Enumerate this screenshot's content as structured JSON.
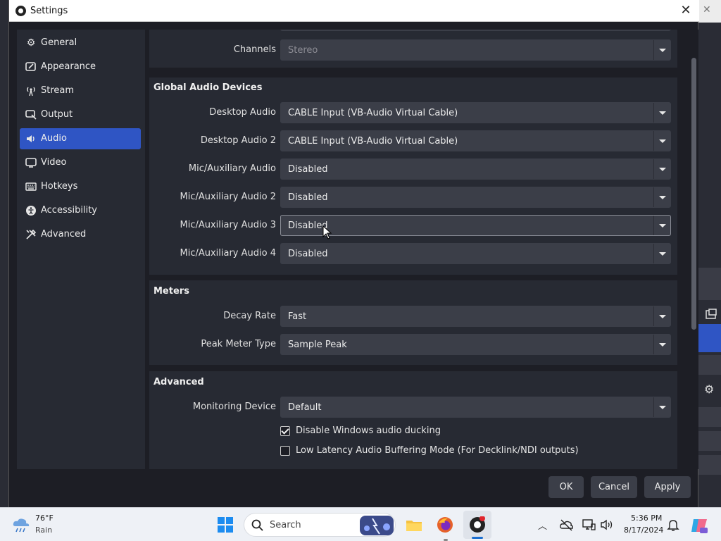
{
  "window": {
    "title": "Settings"
  },
  "sidebar": {
    "items": [
      {
        "label": "General",
        "icon": "gear-icon"
      },
      {
        "label": "Appearance",
        "icon": "appearance-icon"
      },
      {
        "label": "Stream",
        "icon": "antenna-icon"
      },
      {
        "label": "Output",
        "icon": "output-icon"
      },
      {
        "label": "Audio",
        "icon": "speaker-icon",
        "active": true
      },
      {
        "label": "Video",
        "icon": "monitor-icon"
      },
      {
        "label": "Hotkeys",
        "icon": "keyboard-icon"
      },
      {
        "label": "Accessibility",
        "icon": "accessibility-icon"
      },
      {
        "label": "Advanced",
        "icon": "tools-icon"
      }
    ]
  },
  "general": {
    "channels_label": "Channels",
    "channels_value": "Stereo"
  },
  "global_audio": {
    "title": "Global Audio Devices",
    "rows": [
      {
        "label": "Desktop Audio",
        "value": "CABLE Input (VB-Audio Virtual Cable)"
      },
      {
        "label": "Desktop Audio 2",
        "value": "CABLE Input (VB-Audio Virtual Cable)"
      },
      {
        "label": "Mic/Auxiliary Audio",
        "value": "Disabled"
      },
      {
        "label": "Mic/Auxiliary Audio 2",
        "value": "Disabled"
      },
      {
        "label": "Mic/Auxiliary Audio 3",
        "value": "Disabled"
      },
      {
        "label": "Mic/Auxiliary Audio 4",
        "value": "Disabled"
      }
    ]
  },
  "meters": {
    "title": "Meters",
    "rows": [
      {
        "label": "Decay Rate",
        "value": "Fast"
      },
      {
        "label": "Peak Meter Type",
        "value": "Sample Peak"
      }
    ]
  },
  "advanced": {
    "title": "Advanced",
    "monitoring_label": "Monitoring Device",
    "monitoring_value": "Default",
    "ducking_label": "Disable Windows audio ducking",
    "ducking_checked": true,
    "low_latency_label": "Low Latency Audio Buffering Mode (For Decklink/NDI outputs)",
    "low_latency_checked": false
  },
  "buttons": {
    "ok": "OK",
    "cancel": "Cancel",
    "apply": "Apply"
  },
  "taskbar": {
    "weather_temp": "76°F",
    "weather_desc": "Rain",
    "search_label": "Search",
    "time": "5:36 PM",
    "date": "8/17/2024"
  },
  "colors": {
    "accent": "#2f55c4",
    "panel": "#272a33",
    "background": "#1d1e25",
    "control": "#3b3e48"
  }
}
